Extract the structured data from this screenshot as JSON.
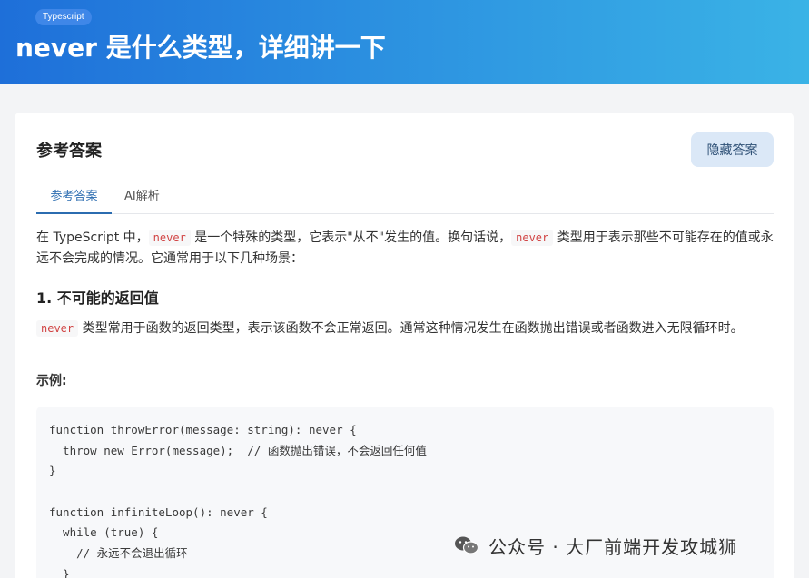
{
  "header": {
    "tag": "Typescript",
    "title": "never 是什么类型，详细讲一下"
  },
  "card": {
    "title": "参考答案",
    "hide_button": "隐藏答案",
    "tabs": [
      {
        "label": "参考答案",
        "active": true
      },
      {
        "label": "AI解析",
        "active": false
      }
    ]
  },
  "content": {
    "intro": {
      "t1": "在 TypeScript 中，",
      "c1": "never",
      "t2": " 是一个特殊的类型，它表示\"从不\"发生的值。换句话说，",
      "c2": "never",
      "t3": " 类型用于表示那些不可能存在的值或永远不会完成的情况。它通常用于以下几种场景："
    },
    "section1_title": "1. 不可能的返回值",
    "section1_para": {
      "c1": "never",
      "t1": " 类型常用于函数的返回类型，表示该函数不会正常返回。通常这种情况发生在函数抛出错误或者函数进入无限循环时。"
    },
    "example_label": "示例:",
    "code_lines": [
      "function throwError(message: string): never {",
      "  throw new Error(message);  // 函数抛出错误，不会返回任何值",
      "}",
      "",
      "function infiniteLoop(): never {",
      "  while (true) {",
      "    // 永远不会退出循环",
      "  }"
    ]
  },
  "watermark": {
    "icon": "wechat-icon",
    "text": "公众号 · 大厂前端开发攻城狮"
  }
}
